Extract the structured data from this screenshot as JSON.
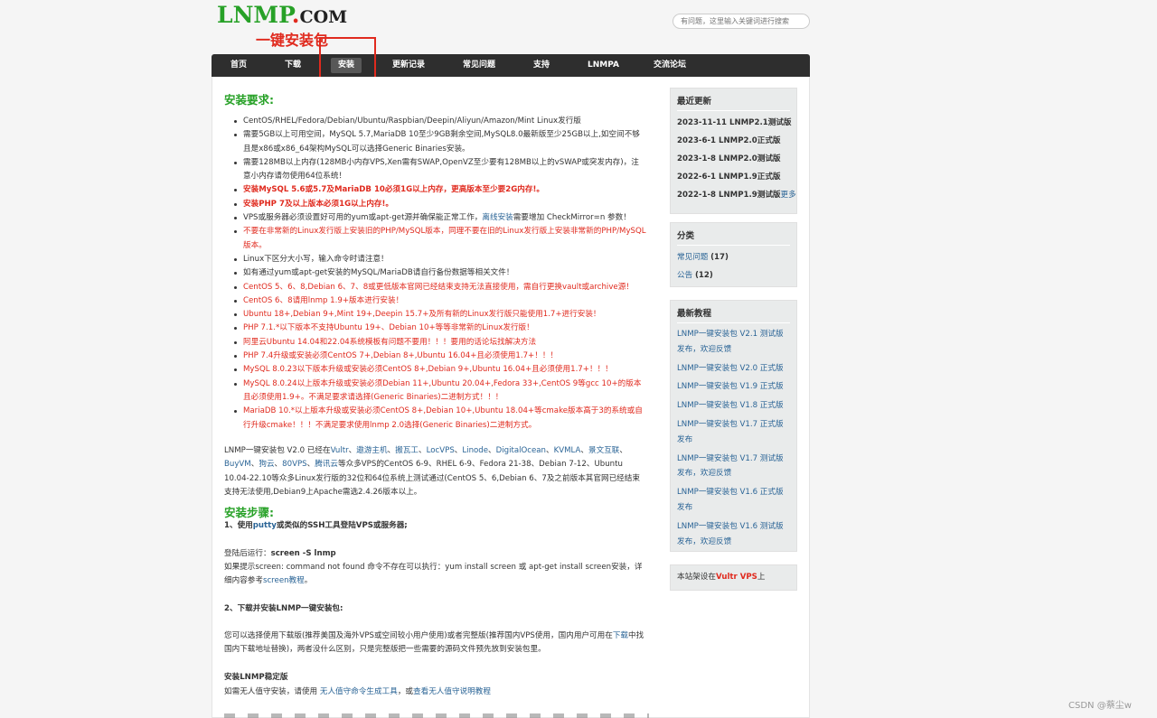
{
  "header": {
    "logo_main": "LNMP",
    "logo_dot": ".",
    "logo_com": "COM",
    "tagline": "一键安装包",
    "search_placeholder": "有问题，这里输入关键词进行搜索"
  },
  "nav": {
    "items": [
      {
        "label": "首页"
      },
      {
        "label": "下载"
      },
      {
        "label": "安装",
        "active": true
      },
      {
        "label": "更新记录"
      },
      {
        "label": "常见问题"
      },
      {
        "label": "支持"
      },
      {
        "label": "LNMPA"
      },
      {
        "label": "交流论坛"
      }
    ]
  },
  "main": {
    "req_title": "安装要求:",
    "requirements": [
      {
        "text": "CentOS/RHEL/Fedora/Debian/Ubuntu/Raspbian/Deepin/Aliyun/Amazon/Mint Linux发行版"
      },
      {
        "text": "需要5GB以上可用空间，MySQL 5.7,MariaDB 10至少9GB剩余空间,MySQL8.0最新版至少25GB以上,如空间不够且是x86或x86_64架构MySQL可以选择Generic Binaries安装。"
      },
      {
        "text": "需要128MB以上内存(128MB小内存VPS,Xen需有SWAP,OpenVZ至少要有128MB以上的vSWAP或突发内存)，注意小内存请勿使用64位系统！"
      },
      {
        "text": "安装MySQL 5.6或5.7及MariaDB 10必须1G以上内存，更高版本至少要2G内存!。",
        "style": "bred"
      },
      {
        "text": "安装PHP 7及以上版本必须1G以上内存!。",
        "style": "bred"
      },
      {
        "text_a": "VPS或服务器必须设置好可用的yum或apt-get源并确保能正常工作，",
        "link": "离线安装",
        "text_b": "需要增加 CheckMirror=n 参数！"
      },
      {
        "text": "不要在非常新的Linux发行版上安装旧的PHP/MySQL版本，同理不要在旧的Linux发行版上安装非常新的PHP/MySQL版本。",
        "style": "red"
      },
      {
        "text": "Linux下区分大小写，输入命令时请注意！"
      },
      {
        "text": "如有通过yum或apt-get安装的MySQL/MariaDB请自行备份数据等相关文件！"
      },
      {
        "text": "CentOS 5、6、8,Debian 6、7、8或更低版本官网已经结束支持无法直接使用，需自行更换vault或archive源！",
        "style": "red"
      },
      {
        "text": "CentOS 6、8请用lnmp 1.9+版本进行安装！",
        "style": "red"
      },
      {
        "text": "Ubuntu 18+,Debian 9+,Mint 19+,Deepin 15.7+及所有新的Linux发行版只能使用1.7+进行安装！",
        "style": "red"
      },
      {
        "text": "PHP 7.1.*以下版本不支持Ubuntu 19+、Debian 10+等等非常新的Linux发行版！",
        "style": "red"
      },
      {
        "text_a": "阿里云Ubuntu 14.04和22.04系统模板有问题不要用！！！",
        "link": "要用的话论坛找解决方法",
        "style": "red"
      },
      {
        "text": "PHP 7.4升级或安装必须CentOS 7+,Debian 8+,Ubuntu 16.04+且必须使用1.7+！！！",
        "style": "red"
      },
      {
        "text": "MySQL 8.0.23以下版本升级或安装必须CentOS 8+,Debian 9+,Ubuntu 16.04+且必须使用1.7+！！！",
        "style": "red"
      },
      {
        "text": "MySQL 8.0.24以上版本升级或安装必须Debian 11+,Ubuntu 20.04+,Fedora 33+,CentOS 9等gcc 10+的版本且必须使用1.9+。不满足要求请选择(Generic Binaries)二进制方式！！！",
        "style": "red"
      },
      {
        "text": "MariaDB 10.*以上版本升级或安装必须CentOS 8+,Debian 10+,Ubuntu 18.04+等cmake版本高于3的系统或自行升级cmake！！！不满足要求使用lnmp 2.0选择(Generic Binaries)二进制方式。",
        "style": "red"
      }
    ],
    "intro_a": "LNMP一键安装包 V2.0 已经在",
    "intro_links": [
      "Vultr",
      "遨游主机",
      "搬瓦工",
      "LocVPS",
      "Linode",
      "DigitalOcean",
      "KVMLA",
      "景文互联",
      "BuyVM",
      "狗云",
      "80VPS",
      "腾讯云"
    ],
    "intro_b": "等众多VPS的CentOS 6-9、RHEL 6-9、Fedora 21-38、Debian 7-12、Ubuntu 10.04-22.10等众多Linux发行版的32位和64位系统上测试通过(CentOS 5、6,Debian 6、7及之前版本其官网已经结束支持无法使用,Debian9上Apache需选2.4.26版本以上。",
    "steps_title": "安装步骤:",
    "step1_a": "1、使用",
    "step1_link": "putty",
    "step1_b": "或类似的SSH工具登陆VPS或服务器;",
    "screen_a": "登陆后运行：",
    "screen_cmd": "screen -S lnmp",
    "screen_note_a": "如果提示screen: command not found 命令不存在可以执行：yum install screen 或 apt-get install screen安装，详细内容参考",
    "screen_note_link": "screen教程",
    "screen_note_b": "。",
    "step2": "2、下载并安装LNMP一键安装包:",
    "step2_desc_a": "您可以选择使用下载版(推荐美国及海外VPS或空间较小用户使用)或者完整版(推荐国内VPS使用，国内用户可用在",
    "step2_desc_link": "下载",
    "step2_desc_b": "中找国内下载地址替换)，两者没什么区别，只是完整版把一些需要的源码文件预先放到安装包里。",
    "stable_title": "安装LNMP稳定版",
    "stable_a": "如需无人值守安装，请使用 ",
    "stable_link1": "无人值守命令生成工具",
    "stable_b": "，或",
    "stable_link2": "查看无人值守说明教程"
  },
  "sidebar": {
    "recent_title": "最近更新",
    "recent": [
      "2023-11-11 LNMP2.1测试版",
      "2023-6-1 LNMP2.0正式版",
      "2023-1-8 LNMP2.0测试版",
      "2022-6-1 LNMP1.9正式版",
      "2022-1-8 LNMP1.9测试版"
    ],
    "more": "更多",
    "cat_title": "分类",
    "cats": [
      {
        "name": "常见问题",
        "count": "(17)"
      },
      {
        "name": "公告",
        "count": "(12)"
      }
    ],
    "tut_title": "最新教程",
    "tutorials": [
      "LNMP一键安装包 V2.1 测试版发布，欢迎反馈",
      "LNMP一键安装包 V2.0 正式版",
      "LNMP一键安装包 V1.9 正式版",
      "LNMP一键安装包 V1.8 正式版",
      "LNMP一键安装包 V1.7 正式版发布",
      "LNMP一键安装包 V1.7 测试版发布，欢迎反馈",
      "LNMP一键安装包 V1.6 正式版发布",
      "LNMP一键安装包 V1.6 测试版发布，欢迎反馈"
    ],
    "host_a": "本站架设在",
    "host_link": "Vultr VPS",
    "host_b": "上"
  },
  "watermark": "CSDN @蔡尘w"
}
